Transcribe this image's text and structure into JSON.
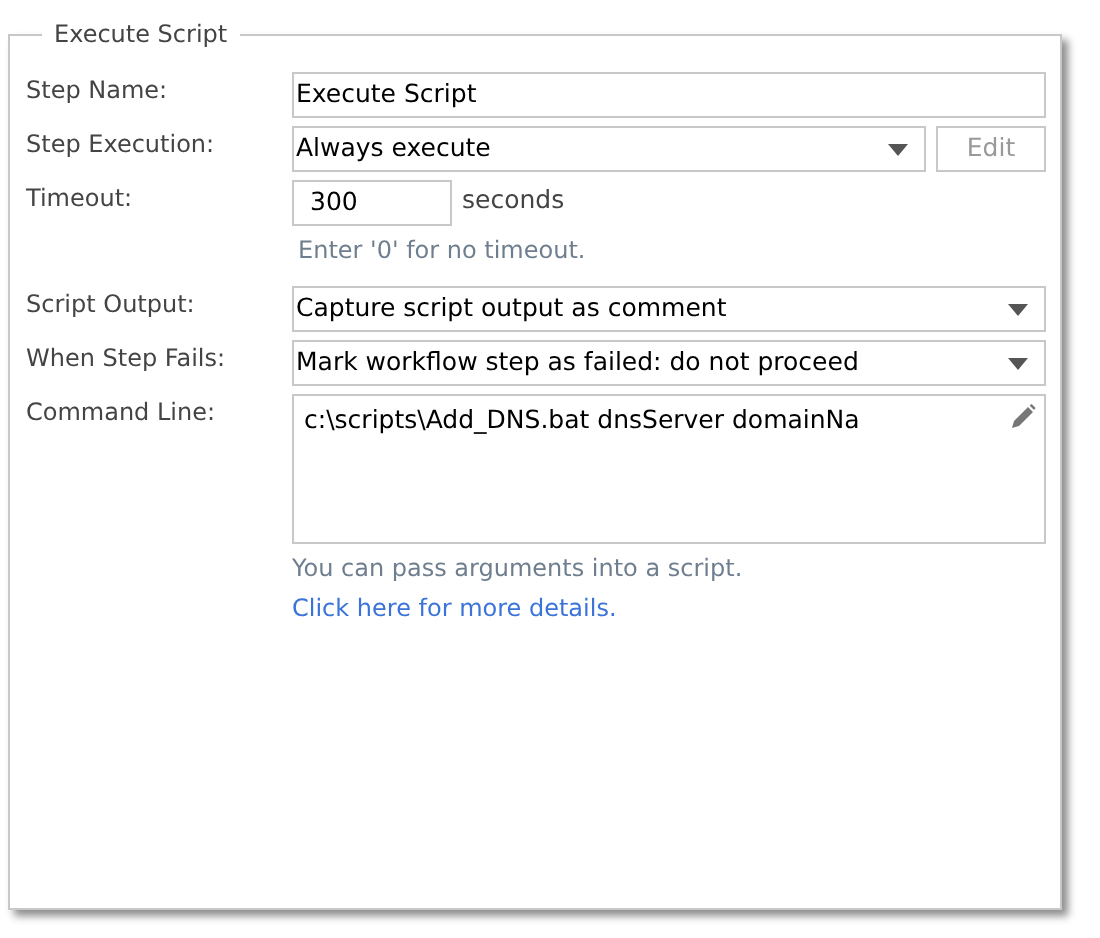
{
  "panel": {
    "legend": "Execute Script"
  },
  "fields": [
    {
      "kind": "text",
      "label": "Step Name:",
      "value": "Execute Script"
    },
    {
      "kind": "select",
      "label": "Step Execution:",
      "value": "Always execute",
      "button": {
        "label": "Edit",
        "disabled": true
      }
    },
    {
      "kind": "number",
      "label": "Timeout:",
      "value": "300",
      "suffix": "seconds",
      "hint": "Enter '0' for no timeout."
    },
    {
      "kind": "select",
      "label": "Script Output:",
      "value": "Capture script output as comment"
    },
    {
      "kind": "select",
      "label": "When Step Fails:",
      "value": "Mark workflow step as failed: do not proceed"
    },
    {
      "kind": "textarea",
      "label": "Command Line:",
      "value": "c:\\scripts\\Add_DNS.bat dnsServer domainNa",
      "hint": "You can pass arguments into a script.",
      "link": "Click here for more details."
    }
  ]
}
